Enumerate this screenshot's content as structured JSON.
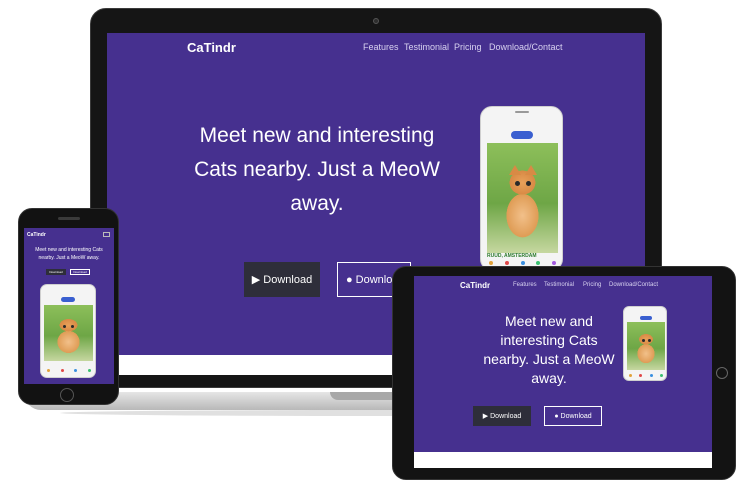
{
  "laptop": {
    "brand": "CaTindr",
    "nav": [
      "Features",
      "Testimonial",
      "Pricing",
      "Download/Contact"
    ],
    "hero_line1": "Meet new and interesting",
    "hero_line2": "Cats nearby. Just a MeoW",
    "hero_line3": "away.",
    "download_label": "Download",
    "download_apple_label": "Downlo",
    "mock_caption": "RUUD, AMSTERDAM"
  },
  "tablet": {
    "brand": "CaTindr",
    "nav": [
      "Features",
      "Testimonial",
      "Pricing",
      "Download/Contact"
    ],
    "hero_line1": "Meet new and",
    "hero_line2": "interesting Cats",
    "hero_line3": "nearby. Just a MeoW",
    "hero_line4": "away.",
    "download_label": "Download",
    "download_apple_label": "Download"
  },
  "phone": {
    "brand": "CaTindr",
    "hero_line1": "Meet new and interesting Cats",
    "hero_line2": "nearby. Just a MeoW away.",
    "download_label": "Download",
    "download_apple_label": "Download"
  },
  "colors": {
    "brand_purple": "#46308f",
    "button_dark": "#2e2e3a"
  }
}
